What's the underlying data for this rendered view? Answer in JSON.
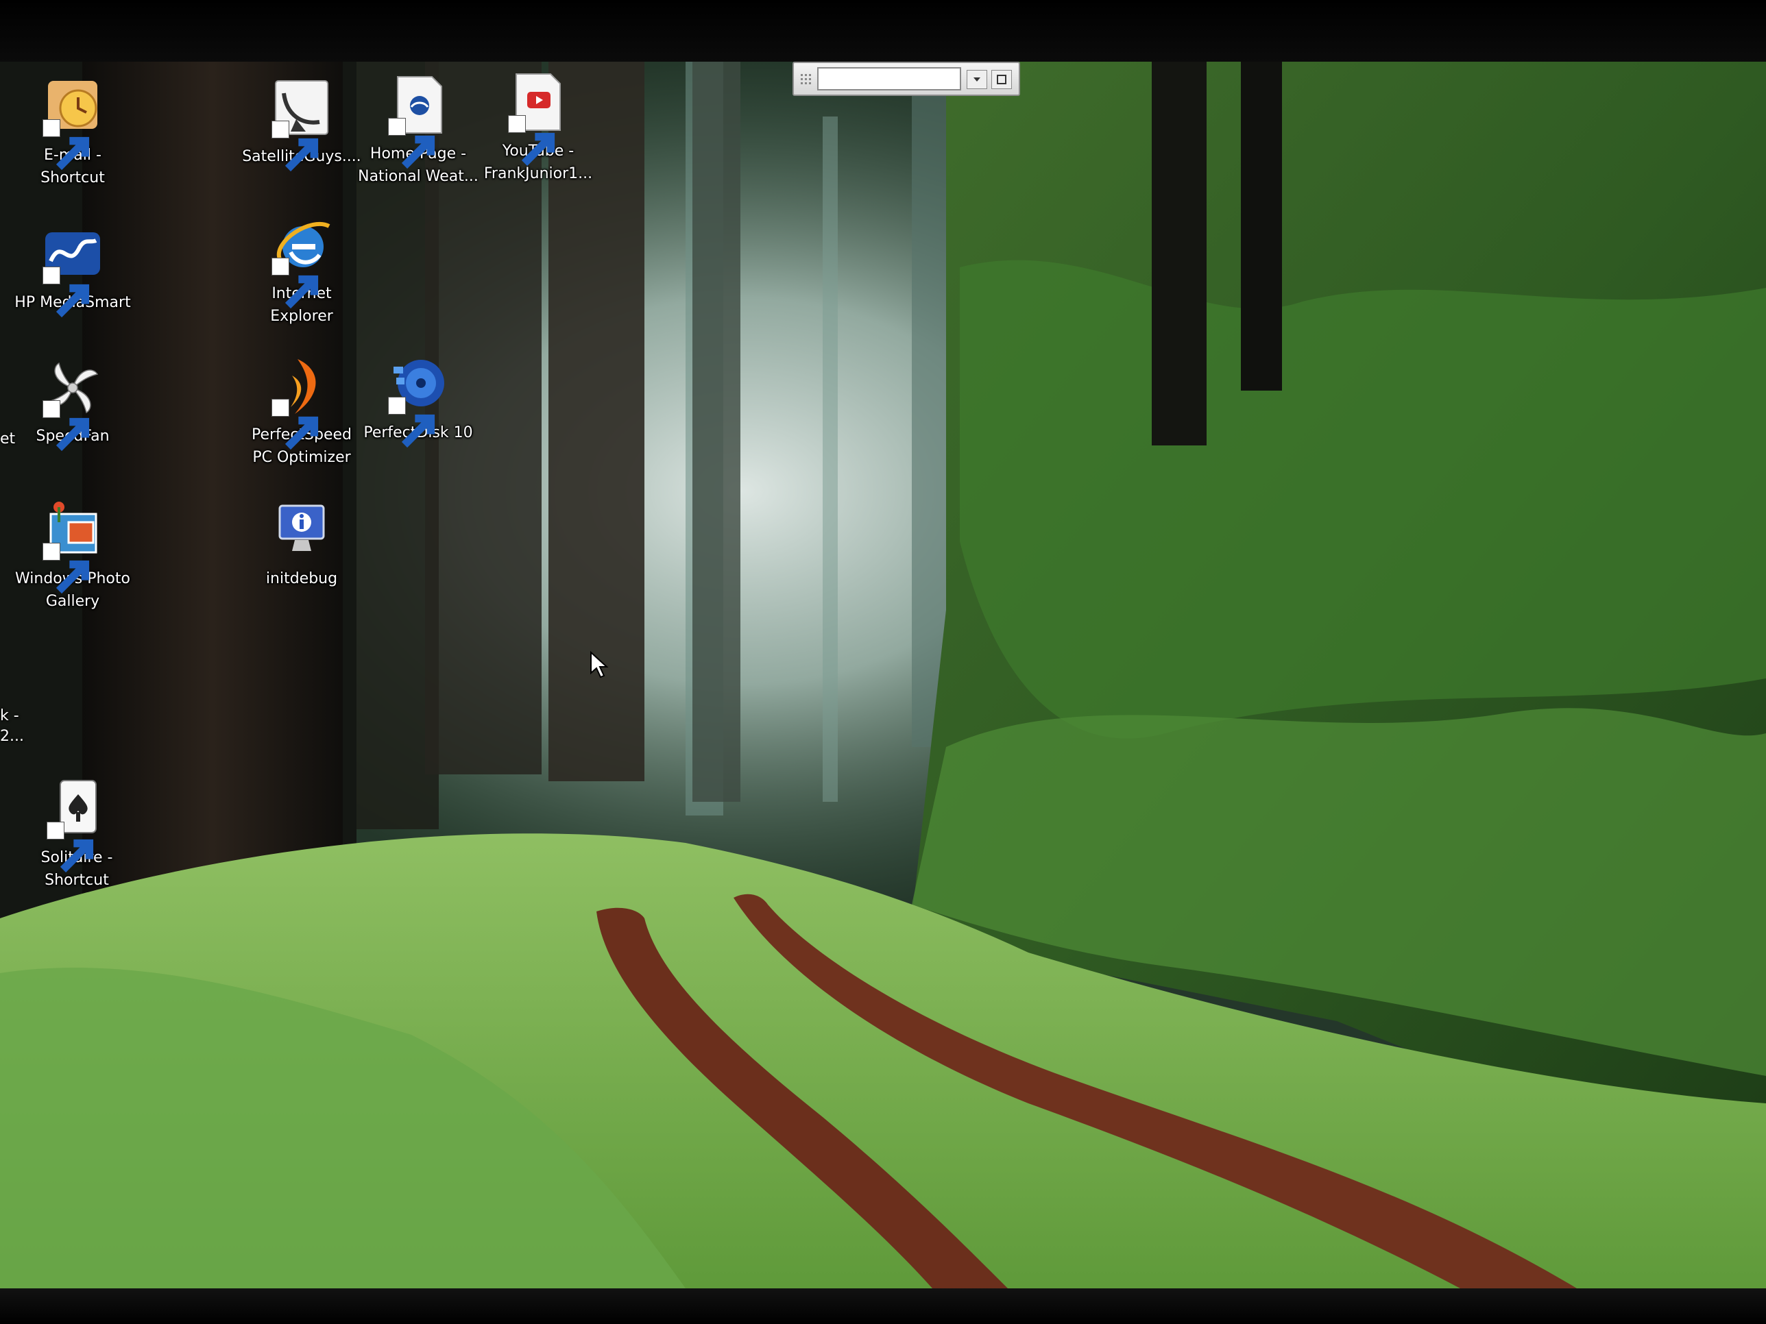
{
  "desktop": {
    "icons": [
      {
        "label": "E-mail -\nShortcut",
        "icon": "email-clock-icon",
        "shortcut": true
      },
      {
        "label": "HP MediaSmart",
        "icon": "hp-mediasmart-icon",
        "shortcut": true
      },
      {
        "label": "SpeedFan",
        "icon": "fan-icon",
        "shortcut": true
      },
      {
        "label": "Windows Photo\nGallery",
        "icon": "photo-gallery-icon",
        "shortcut": true
      },
      {
        "label": "Solitaire -\nShortcut",
        "icon": "playing-card-icon",
        "shortcut": true
      },
      {
        "label": "SatelliteGuys....",
        "icon": "satellite-dish-icon",
        "shortcut": true
      },
      {
        "label": "Internet\nExplorer",
        "icon": "internet-explorer-icon",
        "shortcut": true
      },
      {
        "label": "PerfectSpeed\nPC Optimizer",
        "icon": "perfectspeed-icon",
        "shortcut": true
      },
      {
        "label": "initdebug",
        "icon": "monitor-info-icon",
        "shortcut": false
      },
      {
        "label": "Home Page -\nNational Weat...",
        "icon": "noaa-page-icon",
        "shortcut": true
      },
      {
        "label": "PerfectDisk 10",
        "icon": "perfectdisk-icon",
        "shortcut": true
      },
      {
        "label": "YouTube -\nFrankJunior1...",
        "icon": "youtube-page-icon",
        "shortcut": true
      }
    ],
    "edge_fragments": [
      "et",
      "k -",
      "2..."
    ]
  },
  "floating_toolbar": {
    "input_value": "",
    "grip_icon": "grip-dots-icon",
    "dropdown_icon": "chevron-down-icon",
    "restore_icon": "restore-window-icon"
  },
  "cursor": "arrow-pointer-icon"
}
